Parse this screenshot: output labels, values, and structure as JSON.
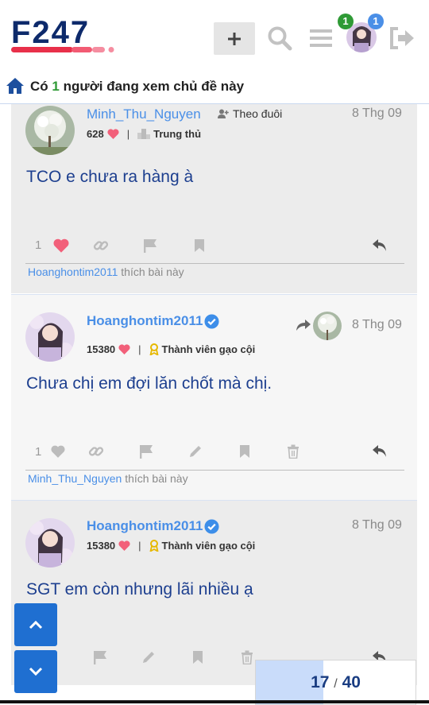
{
  "header": {
    "logo_text": "F247",
    "notification_count": "1",
    "message_count": "1"
  },
  "viewers": {
    "prefix": "Có",
    "count": "1",
    "suffix": "người đang xem chủ đề này"
  },
  "posts": [
    {
      "username": "Minh_Thu_Nguyen",
      "follow_label": "Theo đuôi",
      "date": "8 Thg 09",
      "score": "628",
      "title": "Trung thủ",
      "body": "TCO e chưa ra hàng à",
      "like_count": "1",
      "liked_by": "Hoanghontim2011",
      "liked_suffix": "thích bài này"
    },
    {
      "username": "Hoanghontim2011",
      "date": "8 Thg 09",
      "score": "15380",
      "title": "Thành viên gạo cội",
      "body": "Chưa chị em đợi lăn chốt mà chị.",
      "like_count": "1",
      "liked_by": "Minh_Thu_Nguyen",
      "liked_suffix": "thích bài này"
    },
    {
      "username": "Hoanghontim2011",
      "date": "8 Thg 09",
      "score": "15380",
      "title": "Thành viên gạo cội",
      "body": "SGT em còn nhưng lãi nhiều ạ"
    }
  ],
  "progress": {
    "current": "17",
    "separator": "/",
    "total": "40",
    "fraction": 0.425
  },
  "colors": {
    "accent": "#4a8fe7",
    "brand_navy": "#0d2a6b",
    "brand_red": "#e8304a",
    "heart": "#f2607a",
    "nav_button": "#1f6fd1"
  }
}
